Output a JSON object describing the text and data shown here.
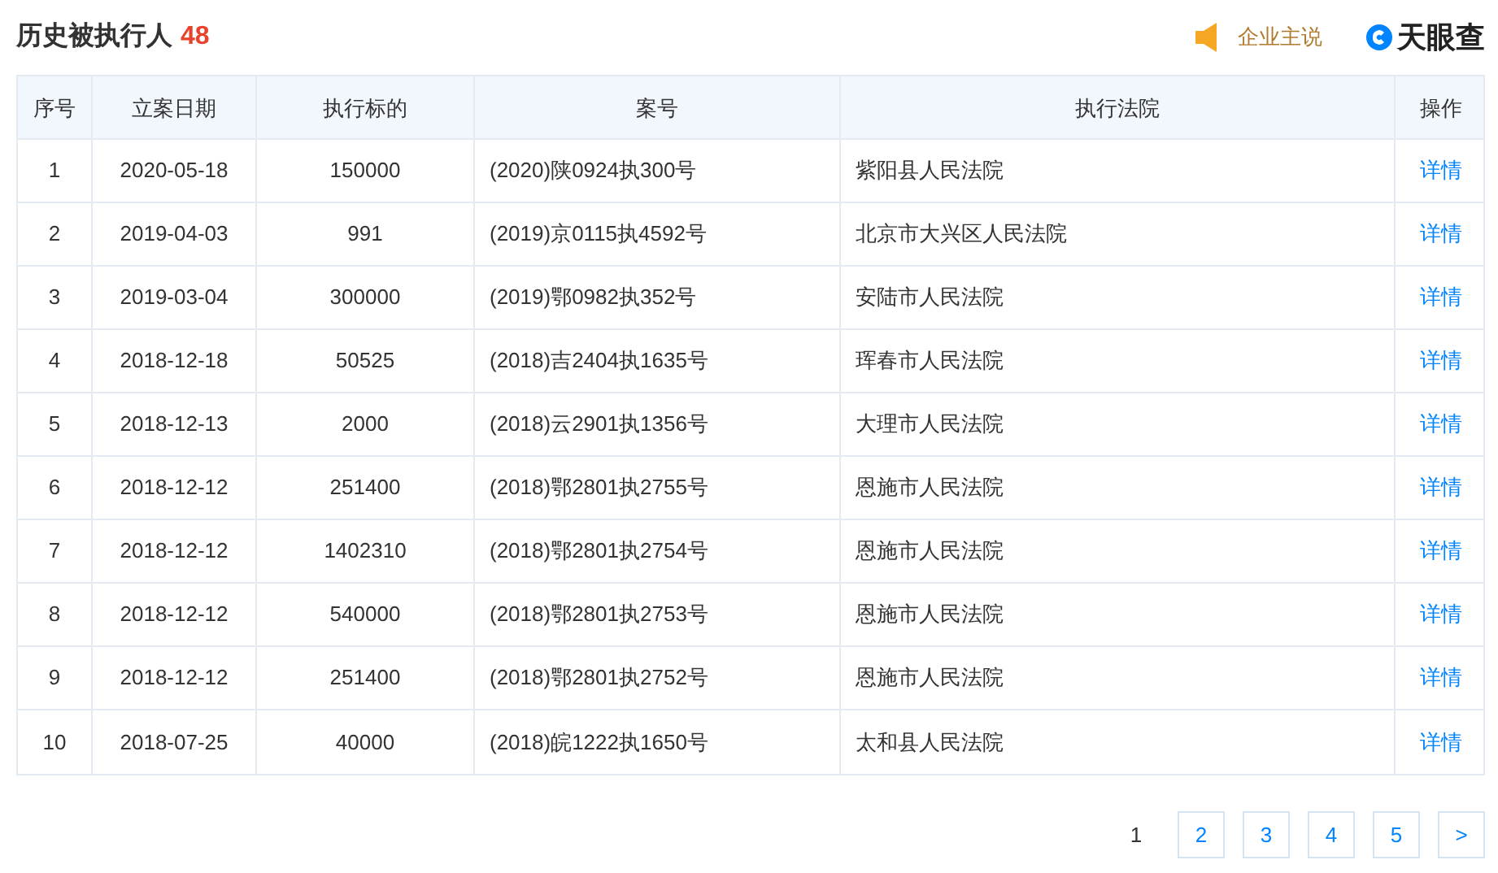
{
  "title": "历史被执行人",
  "count": "48",
  "promo": {
    "label": "企业主说"
  },
  "logo": {
    "text": "天眼查"
  },
  "table": {
    "columns": [
      "序号",
      "立案日期",
      "执行标的",
      "案号",
      "执行法院",
      "操作"
    ],
    "rows": [
      [
        "1",
        "2020-05-18",
        "150000",
        "(2020)陕0924执300号",
        "紫阳县人民法院",
        "详情"
      ],
      [
        "2",
        "2019-04-03",
        "991",
        "(2019)京0115执4592号",
        "北京市大兴区人民法院",
        "详情"
      ],
      [
        "3",
        "2019-03-04",
        "300000",
        "(2019)鄂0982执352号",
        "安陆市人民法院",
        "详情"
      ],
      [
        "4",
        "2018-12-18",
        "50525",
        "(2018)吉2404执1635号",
        "珲春市人民法院",
        "详情"
      ],
      [
        "5",
        "2018-12-13",
        "2000",
        "(2018)云2901执1356号",
        "大理市人民法院",
        "详情"
      ],
      [
        "6",
        "2018-12-12",
        "251400",
        "(2018)鄂2801执2755号",
        "恩施市人民法院",
        "详情"
      ],
      [
        "7",
        "2018-12-12",
        "1402310",
        "(2018)鄂2801执2754号",
        "恩施市人民法院",
        "详情"
      ],
      [
        "8",
        "2018-12-12",
        "540000",
        "(2018)鄂2801执2753号",
        "恩施市人民法院",
        "详情"
      ],
      [
        "9",
        "2018-12-12",
        "251400",
        "(2018)鄂2801执2752号",
        "恩施市人民法院",
        "详情"
      ],
      [
        "10",
        "2018-07-25",
        "40000",
        "(2018)皖1222执1650号",
        "太和县人民法院",
        "详情"
      ]
    ]
  },
  "pagination": [
    {
      "label": "1",
      "selected": true
    },
    {
      "label": "2",
      "selected": false
    },
    {
      "label": "3",
      "selected": false
    },
    {
      "label": "4",
      "selected": false
    },
    {
      "label": "5",
      "selected": false
    },
    {
      "label": ">",
      "selected": false
    }
  ]
}
